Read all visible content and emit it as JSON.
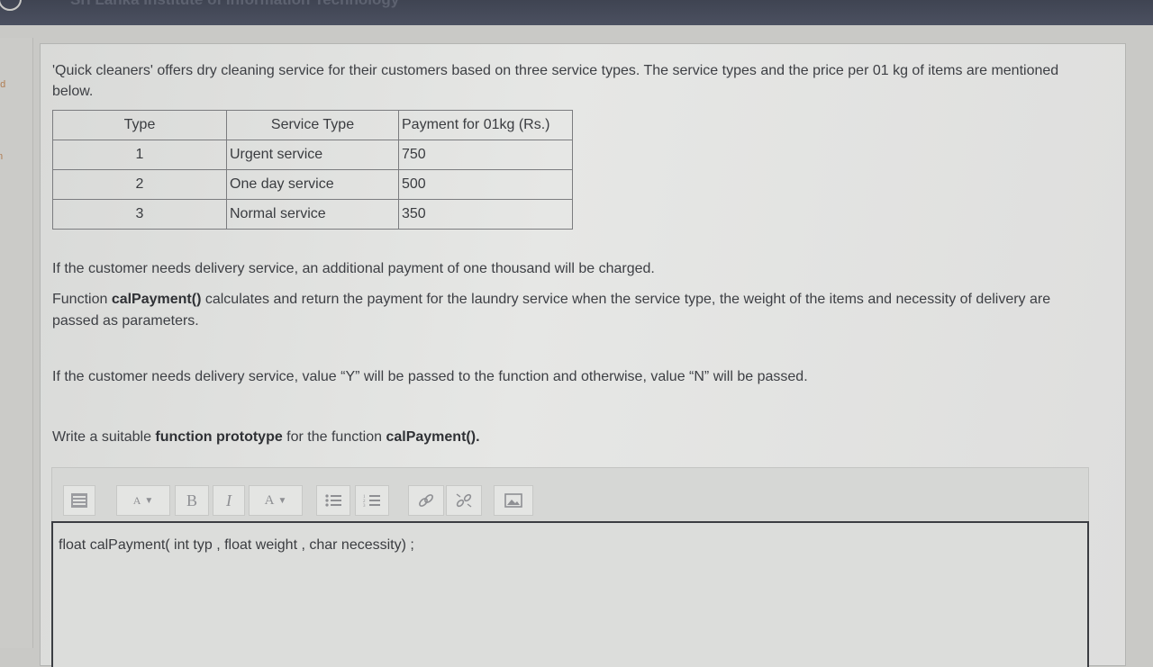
{
  "header": {
    "institute": "Sri Lanka Institute of Information Technology"
  },
  "sidebar": {
    "tabs": [
      "ed",
      "m"
    ]
  },
  "question": {
    "intro": "'Quick cleaners' offers dry cleaning service for their customers based on three service types.  The service types and the price per 01 kg of items are mentioned below.",
    "table": {
      "headers": [
        "Type",
        "Service Type",
        "Payment for 01kg (Rs.)"
      ],
      "rows": [
        [
          "1",
          "Urgent service",
          "750"
        ],
        [
          "2",
          "One day service",
          "500"
        ],
        [
          "3",
          "Normal service",
          "350"
        ]
      ]
    },
    "delivery_note": "If the customer needs delivery service, an additional payment of one thousand will be charged.",
    "function_desc_prefix": "Function ",
    "function_name": "calPayment()",
    "function_desc_suffix": " calculates and return the payment for the laundry service when the service type, the weight of the items and necessity of delivery  are passed as parameters.",
    "param_note": "If the customer needs delivery service, value “Y” will be passed to the function and otherwise, value “N” will be passed.",
    "task_prefix": "Write a suitable ",
    "task_bold": "function prototype",
    "task_middle": " for the function ",
    "task_func": "calPayment()."
  },
  "editor": {
    "toolbar": {
      "font_size_label": "A",
      "bold_label": "B",
      "italic_label": "I",
      "font_color_label": "A"
    },
    "answer": "float calPayment( int typ , float weight , char necessity) ;"
  }
}
